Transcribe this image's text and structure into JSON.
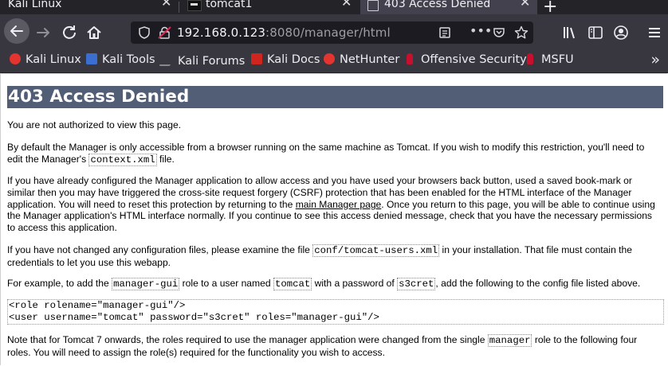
{
  "tabs": [
    {
      "label": "Kali Linux",
      "active": false
    },
    {
      "label": "tomcat1",
      "active": false
    },
    {
      "label": "403 Access Denied",
      "active": true
    }
  ],
  "tab_close_glyph": "✕",
  "new_tab_glyph": "+",
  "url": {
    "host": "192.168.0.123",
    "rest": ":8080/manager/html"
  },
  "bookmarks": [
    {
      "label": "Kali Linux",
      "icon": "kali-icon",
      "color": "#e4342f"
    },
    {
      "label": "Kali Tools",
      "icon": "kali-tools-icon",
      "color": "#3a6fd1"
    },
    {
      "label": "Kali Forums",
      "icon": "kali-forums-icon",
      "color": "#222222"
    },
    {
      "label": "Kali Docs",
      "icon": "kali-docs-icon",
      "color": "#d0241f"
    },
    {
      "label": "NetHunter",
      "icon": "nethunter-icon",
      "color": "#e4342f"
    },
    {
      "label": "Offensive Security",
      "icon": "offsec-icon",
      "color": "#c8102e"
    },
    {
      "label": "MSFU",
      "icon": "msfu-icon",
      "color": "#c8102e"
    }
  ],
  "page": {
    "title": "403 Access Denied",
    "p1": "You are not authorized to view this page.",
    "p2_a": "By default the Manager is only accessible from a browser running on the same machine as Tomcat. If you wish to modify this restriction, you'll need to edit the Manager's ",
    "p2_code": "context.xml",
    "p2_b": " file.",
    "p3_a": "If you have already configured the Manager application to allow access and you have used your browsers back button, used a saved book-mark or similar then you may have triggered the cross-site request forgery (CSRF) protection that has been enabled for the HTML interface of the Manager application. You will need to reset this protection by returning to the ",
    "p3_link": "main Manager page",
    "p3_b": ". Once you return to this page, you will be able to continue using the Manager application's HTML interface normally. If you continue to see this access denied message, check that you have the necessary permissions to access this application.",
    "p4_a": "If you have not changed any configuration files, please examine the file ",
    "p4_code": "conf/tomcat-users.xml",
    "p4_b": " in your installation. That file must contain the credentials to let you use this webapp.",
    "p5_a": "For example, to add the ",
    "p5_code1": "manager-gui",
    "p5_b": " role to a user named ",
    "p5_code2": "tomcat",
    "p5_c": " with a password of ",
    "p5_code3": "s3cret",
    "p5_d": ", add the following to the config file listed above.",
    "pre_line1": "<role rolename=\"manager-gui\"/>",
    "pre_line2": "<user username=\"tomcat\" password=\"s3cret\" roles=\"manager-gui\"/>",
    "p6_a": "Note that for Tomcat 7 onwards, the roles required to use the manager application were changed from the single ",
    "p6_code": "manager",
    "p6_b": " role to the following four roles. You will need to assign the role(s) required for the functionality you wish to access."
  }
}
